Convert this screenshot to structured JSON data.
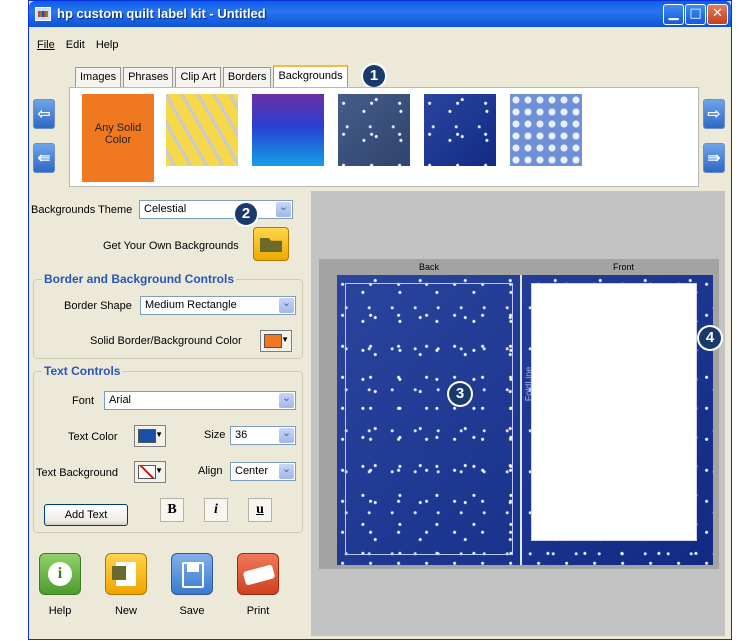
{
  "window": {
    "title": "hp custom quilt label kit - Untitled"
  },
  "menu": [
    "File",
    "Edit",
    "Help"
  ],
  "tabs": [
    "Images",
    "Phrases",
    "Clip Art",
    "Borders",
    "Backgrounds"
  ],
  "active_tab": "Backgrounds",
  "callouts": [
    "1",
    "2",
    "3",
    "4"
  ],
  "strip": {
    "solid_label": "Any Solid Color"
  },
  "backgrounds_theme": {
    "label": "Backgrounds Theme",
    "value": "Celestial",
    "get_own_label": "Get Your Own Backgrounds"
  },
  "border_controls": {
    "title": "Border and Background Controls",
    "shape_label": "Border Shape",
    "shape_value": "Medium Rectangle",
    "color_label": "Solid Border/Background Color",
    "color": "#f07820"
  },
  "text_controls": {
    "title": "Text Controls",
    "font_label": "Font",
    "font_value": "Arial",
    "text_color_label": "Text Color",
    "text_color": "#1a4fa8",
    "size_label": "Size",
    "size_value": "36",
    "text_bg_label": "Text Background",
    "align_label": "Align",
    "align_value": "Center",
    "add_text_label": "Add Text",
    "bold": "B",
    "italic": "i",
    "underline": "u"
  },
  "actions": [
    "Help",
    "New",
    "Save",
    "Print"
  ],
  "preview": {
    "back_label": "Back",
    "front_label": "Front",
    "fold_label": "FoldLine"
  },
  "colors": {
    "accent_blue": "#2a55b5",
    "title_bar": "#0a5ee8",
    "orange": "#f07820",
    "navy": "#112a86"
  }
}
